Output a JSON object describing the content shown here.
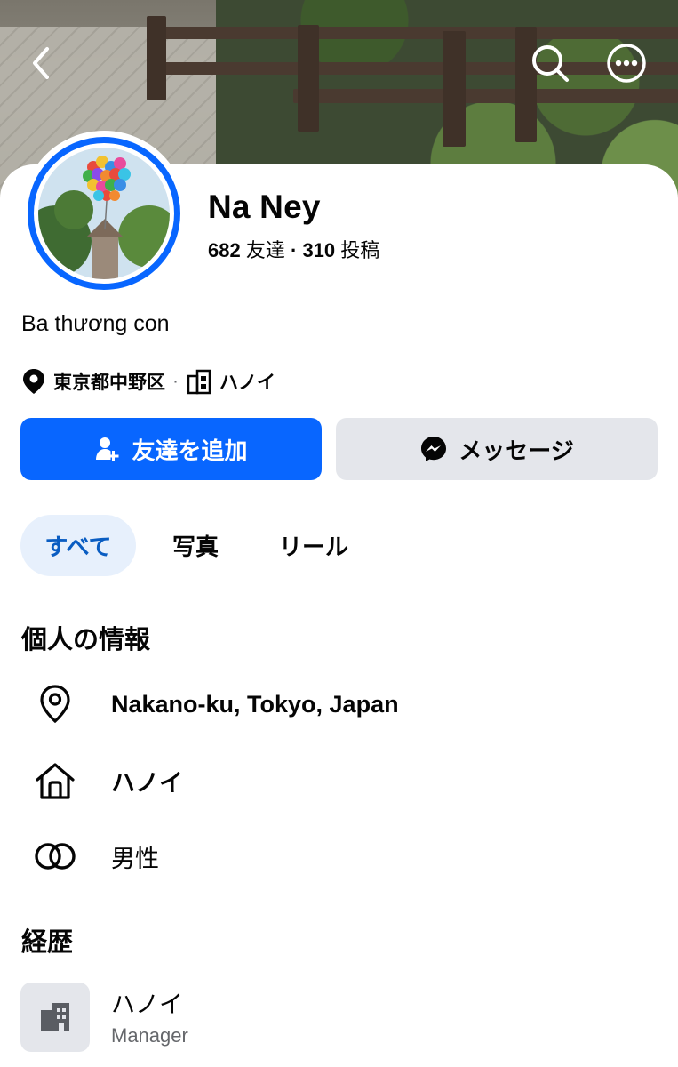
{
  "profile": {
    "name": "Na Ney",
    "friends_count": "682",
    "friends_label": "友達",
    "stats_separator": "·",
    "posts_count": "310",
    "posts_label": "投稿",
    "bio": "Ba thương con",
    "location_short": "東京都中野区",
    "location_separator": "·",
    "hometown_short": "ハノイ"
  },
  "actions": {
    "add_friend_label": "友達を追加",
    "message_label": "メッセージ"
  },
  "tabs": [
    {
      "label": "すべて",
      "selected": true
    },
    {
      "label": "写真",
      "selected": false
    },
    {
      "label": "リール",
      "selected": false
    }
  ],
  "personal_info": {
    "title": "個人の情報",
    "location": "Nakano-ku, Tokyo, Japan",
    "hometown": "ハノイ",
    "gender": "男性"
  },
  "career": {
    "title": "経歴",
    "items": [
      {
        "name": "ハノイ",
        "role": "Manager"
      }
    ]
  },
  "icons": {
    "back": "chevron-left-icon",
    "search": "search-icon",
    "more": "more-horizontal-icon",
    "location": "map-pin-icon",
    "building": "building-icon",
    "add_friend": "add-friend-icon",
    "messenger": "messenger-icon",
    "home": "home-icon",
    "gender": "gender-rings-icon",
    "work": "workplace-icon"
  },
  "colors": {
    "primary": "#0866ff",
    "secondary_button": "#e4e6eb",
    "selected_tab_bg": "#e7f0fc",
    "selected_tab_text": "#0a5dc2",
    "muted_text": "#65676b"
  }
}
